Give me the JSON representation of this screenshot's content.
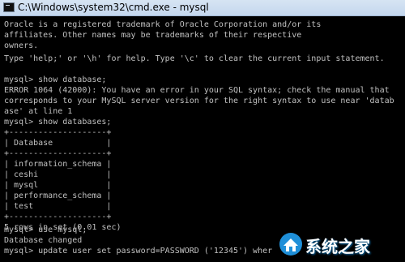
{
  "window": {
    "title": "C:\\Windows\\system32\\cmd.exe - mysql"
  },
  "console": {
    "lines": [
      "Oracle is a registered trademark of Oracle Corporation and/or its",
      "affiliates. Other names may be trademarks of their respective",
      "owners.",
      "",
      "Type 'help;' or '\\h' for help. Type '\\c' to clear the current input statement.",
      "",
      "mysql> show database;",
      "ERROR 1064 (42000): You have an error in your SQL syntax; check the manual that",
      "corresponds to your MySQL server version for the right syntax to use near 'datab",
      "ase' at line 1",
      "mysql> show databases;",
      "+--------------------+",
      "| Database           |",
      "+--------------------+",
      "| information_schema |",
      "| ceshi              |",
      "| mysql              |",
      "| performance_schema |",
      "| test               |",
      "+--------------------+",
      "5 rows in set (0.01 sec)",
      "",
      "mysql> use mysql;",
      "Database changed",
      "mysql> update user set password=PASSWORD ('12345') wher"
    ]
  },
  "watermark": {
    "text": "系统之家"
  },
  "colors": {
    "console_bg": "#000000",
    "console_text": "#c0c0c0",
    "watermark_blue": "#1f8fd8"
  }
}
